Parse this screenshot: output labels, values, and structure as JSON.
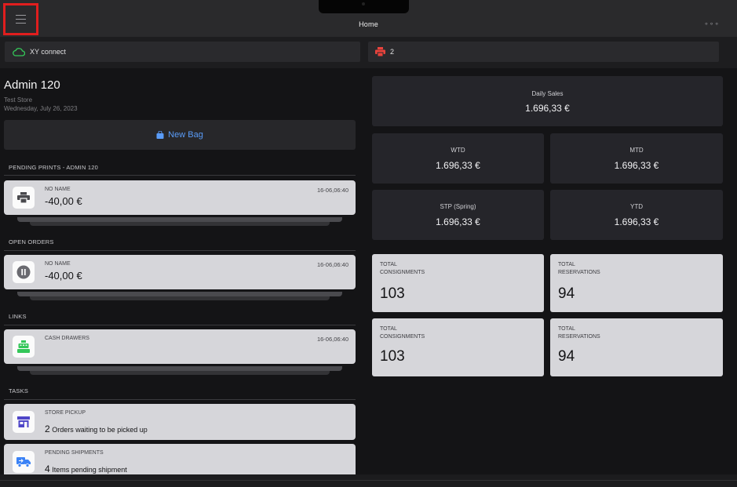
{
  "header": {
    "title": "Home",
    "more": "∘∘∘",
    "menu_icon": "hamburger-icon"
  },
  "status": {
    "connection_label": "XY connect",
    "printer_count": "2",
    "accent_red": "#e9433c",
    "accent_green": "#34c759"
  },
  "user": {
    "name": "Admin 120",
    "store": "Test Store",
    "date": "Wednesday, July 26, 2023"
  },
  "new_bag": {
    "label": "New Bag",
    "color": "#5a9cf8"
  },
  "sections": {
    "pending_prints": "PENDING PRINTS - ADMIN 120",
    "open_orders": "OPEN ORDERS",
    "links": "LINKS",
    "tasks": "TASKS"
  },
  "pending_print": {
    "name": "NO NAME",
    "amount": "-40,00 €",
    "time": "16-06,06:40",
    "icon": "printer-icon"
  },
  "open_order": {
    "name": "NO NAME",
    "amount": "-40,00 €",
    "time": "16-06,06:40",
    "icon": "pause-icon"
  },
  "link": {
    "name": "CASH DRAWERS",
    "time": "16-06,06:40",
    "icon": "cash-register-icon"
  },
  "tasks": [
    {
      "title": "STORE PICKUP",
      "count": "2",
      "text": "Orders waiting to be picked up",
      "icon": "store-icon"
    },
    {
      "title": "PENDING SHIPMENTS",
      "count": "4",
      "text": "Items pending shipment",
      "icon": "shipping-truck-icon"
    }
  ],
  "stats": {
    "daily": {
      "label": "Daily Sales",
      "value": "1.696,33 €"
    },
    "wtd": {
      "label": "WTD",
      "value": "1.696,33 €"
    },
    "mtd": {
      "label": "MTD",
      "value": "1.696,33 €"
    },
    "stp": {
      "label": "STP (Spring)",
      "value": "1.696,33 €"
    },
    "ytd": {
      "label": "YTD",
      "value": "1.696,33 €"
    }
  },
  "tiles": [
    {
      "l1": "TOTAL",
      "l2": "CONSIGNMENTS",
      "value": "103"
    },
    {
      "l1": "TOTAL",
      "l2": "RESERVATIONS",
      "value": "94"
    },
    {
      "l1": "TOTAL",
      "l2": "CONSIGNMENTS",
      "value": "103"
    },
    {
      "l1": "TOTAL",
      "l2": "RESERVATIONS",
      "value": "94"
    }
  ]
}
